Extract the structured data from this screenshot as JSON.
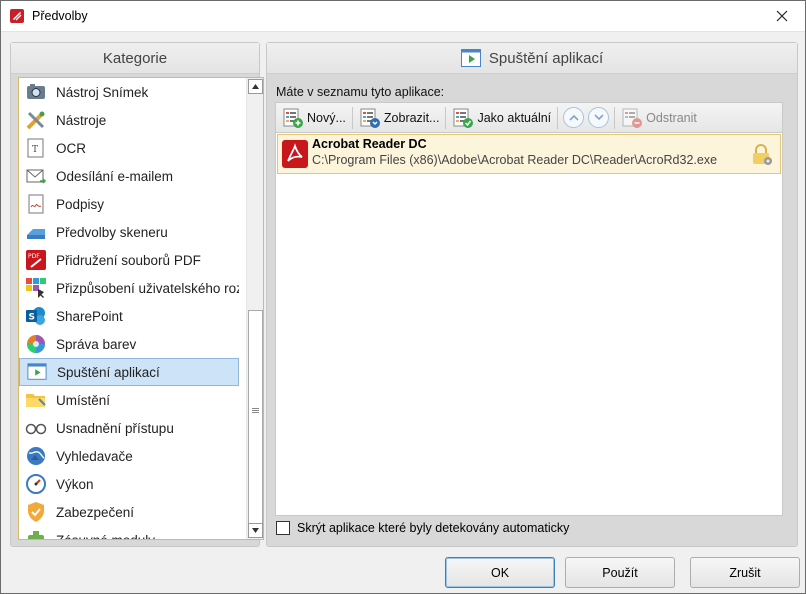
{
  "window": {
    "title": "Předvolby",
    "close_symbol": "✕"
  },
  "left": {
    "header": "Kategorie",
    "items": [
      {
        "label": "Nástroj Snímek",
        "icon": "camera-icon"
      },
      {
        "label": "Nástroje",
        "icon": "tools-icon"
      },
      {
        "label": "OCR",
        "icon": "ocr-icon"
      },
      {
        "label": "Odesílání e-mailem",
        "icon": "mail-icon"
      },
      {
        "label": "Podpisy",
        "icon": "signature-icon"
      },
      {
        "label": "Předvolby skeneru",
        "icon": "scanner-icon"
      },
      {
        "label": "Přidružení souborů PDF",
        "icon": "pdf-association-icon"
      },
      {
        "label": "Přizpůsobení uživatelského roz",
        "icon": "customize-ui-icon"
      },
      {
        "label": "SharePoint",
        "icon": "sharepoint-icon"
      },
      {
        "label": "Správa barev",
        "icon": "color-management-icon"
      },
      {
        "label": "Spuštění aplikací",
        "icon": "launch-apps-icon",
        "selected": true
      },
      {
        "label": "Umístění",
        "icon": "folder-icon"
      },
      {
        "label": "Usnadnění přístupu",
        "icon": "accessibility-icon"
      },
      {
        "label": "Vyhledavače",
        "icon": "search-engines-icon"
      },
      {
        "label": "Výkon",
        "icon": "performance-icon"
      },
      {
        "label": "Zabezpečení",
        "icon": "security-shield-icon"
      },
      {
        "label": "Zásuvné moduly",
        "icon": "plugins-icon"
      }
    ]
  },
  "right": {
    "header": "Spuštění aplikací",
    "apps_label": "Máte v seznamu tyto aplikace:",
    "toolbar": {
      "new_label": "Nový...",
      "browse_label": "Zobrazit...",
      "current_label": "Jako aktuální",
      "remove_label": "Odstranit"
    },
    "apps": [
      {
        "name": "Acrobat Reader DC",
        "path": "C:\\Program Files (x86)\\Adobe\\Acrobat Reader DC\\Reader\\AcroRd32.exe"
      }
    ],
    "hide_auto_label": "Skrýt aplikace které byly detekovány automaticky",
    "hide_auto_checked": false
  },
  "buttons": {
    "ok": "OK",
    "apply": "Použít",
    "cancel": "Zrušit"
  },
  "colors": {
    "selection": "#cde3f7",
    "app_row": "#fdf4dc",
    "list_border": "#d7b96a"
  }
}
